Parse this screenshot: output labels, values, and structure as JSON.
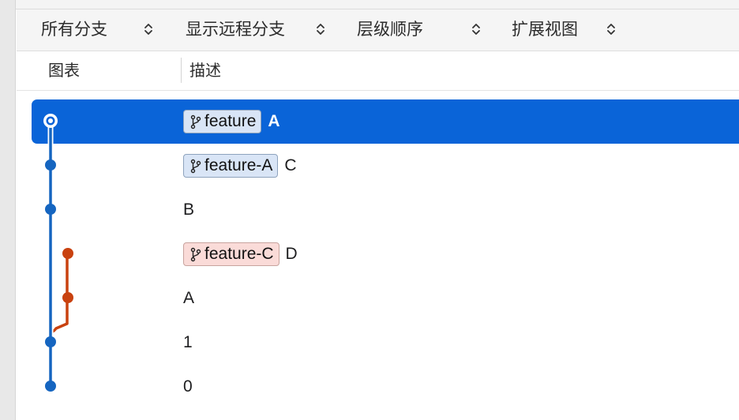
{
  "toolbar": {
    "branches_select": "所有分支",
    "remote_select": "显示远程分支",
    "order_select": "层级顺序",
    "view_select": "扩展视图"
  },
  "columns": {
    "graph": "图表",
    "description": "描述"
  },
  "commits": [
    {
      "message": "A",
      "branch": "feature",
      "branch_color": "blue",
      "selected": true,
      "lane": 0
    },
    {
      "message": "C",
      "branch": "feature-A",
      "branch_color": "blue",
      "selected": false,
      "lane": 0
    },
    {
      "message": "B",
      "branch": null,
      "selected": false,
      "lane": 0
    },
    {
      "message": "D",
      "branch": "feature-C",
      "branch_color": "red",
      "selected": false,
      "lane": 1
    },
    {
      "message": "A",
      "branch": null,
      "selected": false,
      "lane": 1
    },
    {
      "message": "1",
      "branch": null,
      "selected": false,
      "lane": 0
    },
    {
      "message": "0",
      "branch": null,
      "selected": false,
      "lane": 0
    }
  ],
  "colors": {
    "selection": "#0a64d8",
    "lane_main": "#1565c0",
    "lane_branch": "#c9420f",
    "tag_blue_bg": "#d9e5f6",
    "tag_red_bg": "#fadbd8"
  },
  "icons": {
    "branch_tag": "branch-icon",
    "select_arrows": "chevron-updown-icon",
    "current_head": "head-ring-icon"
  }
}
